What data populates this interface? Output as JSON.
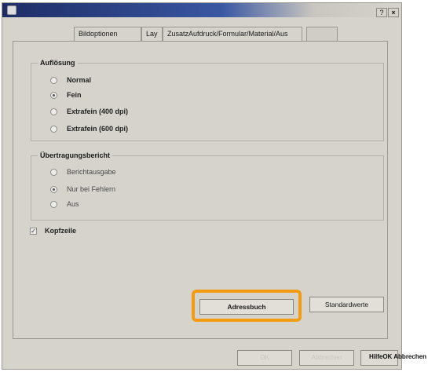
{
  "window": {
    "help_button": "?",
    "close_button": "×"
  },
  "tabs": [
    {
      "label": "Bildoptionen"
    },
    {
      "label": "Lay"
    },
    {
      "label": "ZusatzAufdruck/Formular/Material/Aus"
    },
    {
      "label": ""
    }
  ],
  "resolution_group": {
    "title": "Auflösung",
    "options": [
      {
        "label": "Normal",
        "checked": false
      },
      {
        "label": "Fein",
        "checked": true
      },
      {
        "label": "Extrafein (400 dpi)",
        "checked": false
      },
      {
        "label": "Extrafein (600 dpi)",
        "checked": false
      }
    ]
  },
  "report_group": {
    "title": "Übertragungsbericht",
    "options": [
      {
        "label": "Berichtausgabe",
        "checked": false
      },
      {
        "label": "Nur bei Fehlern",
        "checked": true
      },
      {
        "label": "Aus",
        "checked": false
      }
    ]
  },
  "header_checkbox": {
    "label": "Kopfzeile",
    "checked": true,
    "mark": "✓"
  },
  "buttons": {
    "address_book": "Adressbuch",
    "defaults": "Standardwerte"
  },
  "footer": {
    "ok": "OK",
    "cancel": "Abbrechen",
    "help": "",
    "text": "HilfeOK Abbrechen"
  },
  "colors": {
    "highlight": "#f39c12",
    "titlebar": "#1d2c66",
    "dialog_bg": "#d6d3cd"
  }
}
